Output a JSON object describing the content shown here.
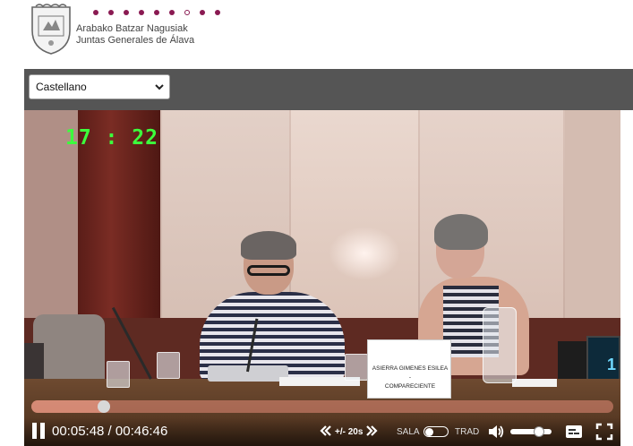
{
  "header": {
    "org_line1": "Arabako Batzar Nagusiak",
    "org_line2": "Juntas Generales de Álava",
    "brand_color": "#8a1a52",
    "crest_icon": "coat-of-arms-icon"
  },
  "language": {
    "selected": "Castellano"
  },
  "video": {
    "timestamp_overlay": "17 : 22",
    "nameplate": {
      "line1": "ASIERRA GIMENES ESILEA",
      "line2": "-",
      "line3": "COMPARECIENTE"
    },
    "screen_digit": "1"
  },
  "player": {
    "time_display": "00:05:48 / 00:46:46",
    "progress_fraction": 0.124,
    "seek_label": "+/- 20s",
    "sala_label": "SALA",
    "trad_label": "TRAD",
    "volume_fraction": 0.7,
    "icons": [
      "pause-icon",
      "rewind-icon",
      "forward-icon",
      "volume-icon",
      "captions-icon",
      "fullscreen-icon"
    ]
  }
}
